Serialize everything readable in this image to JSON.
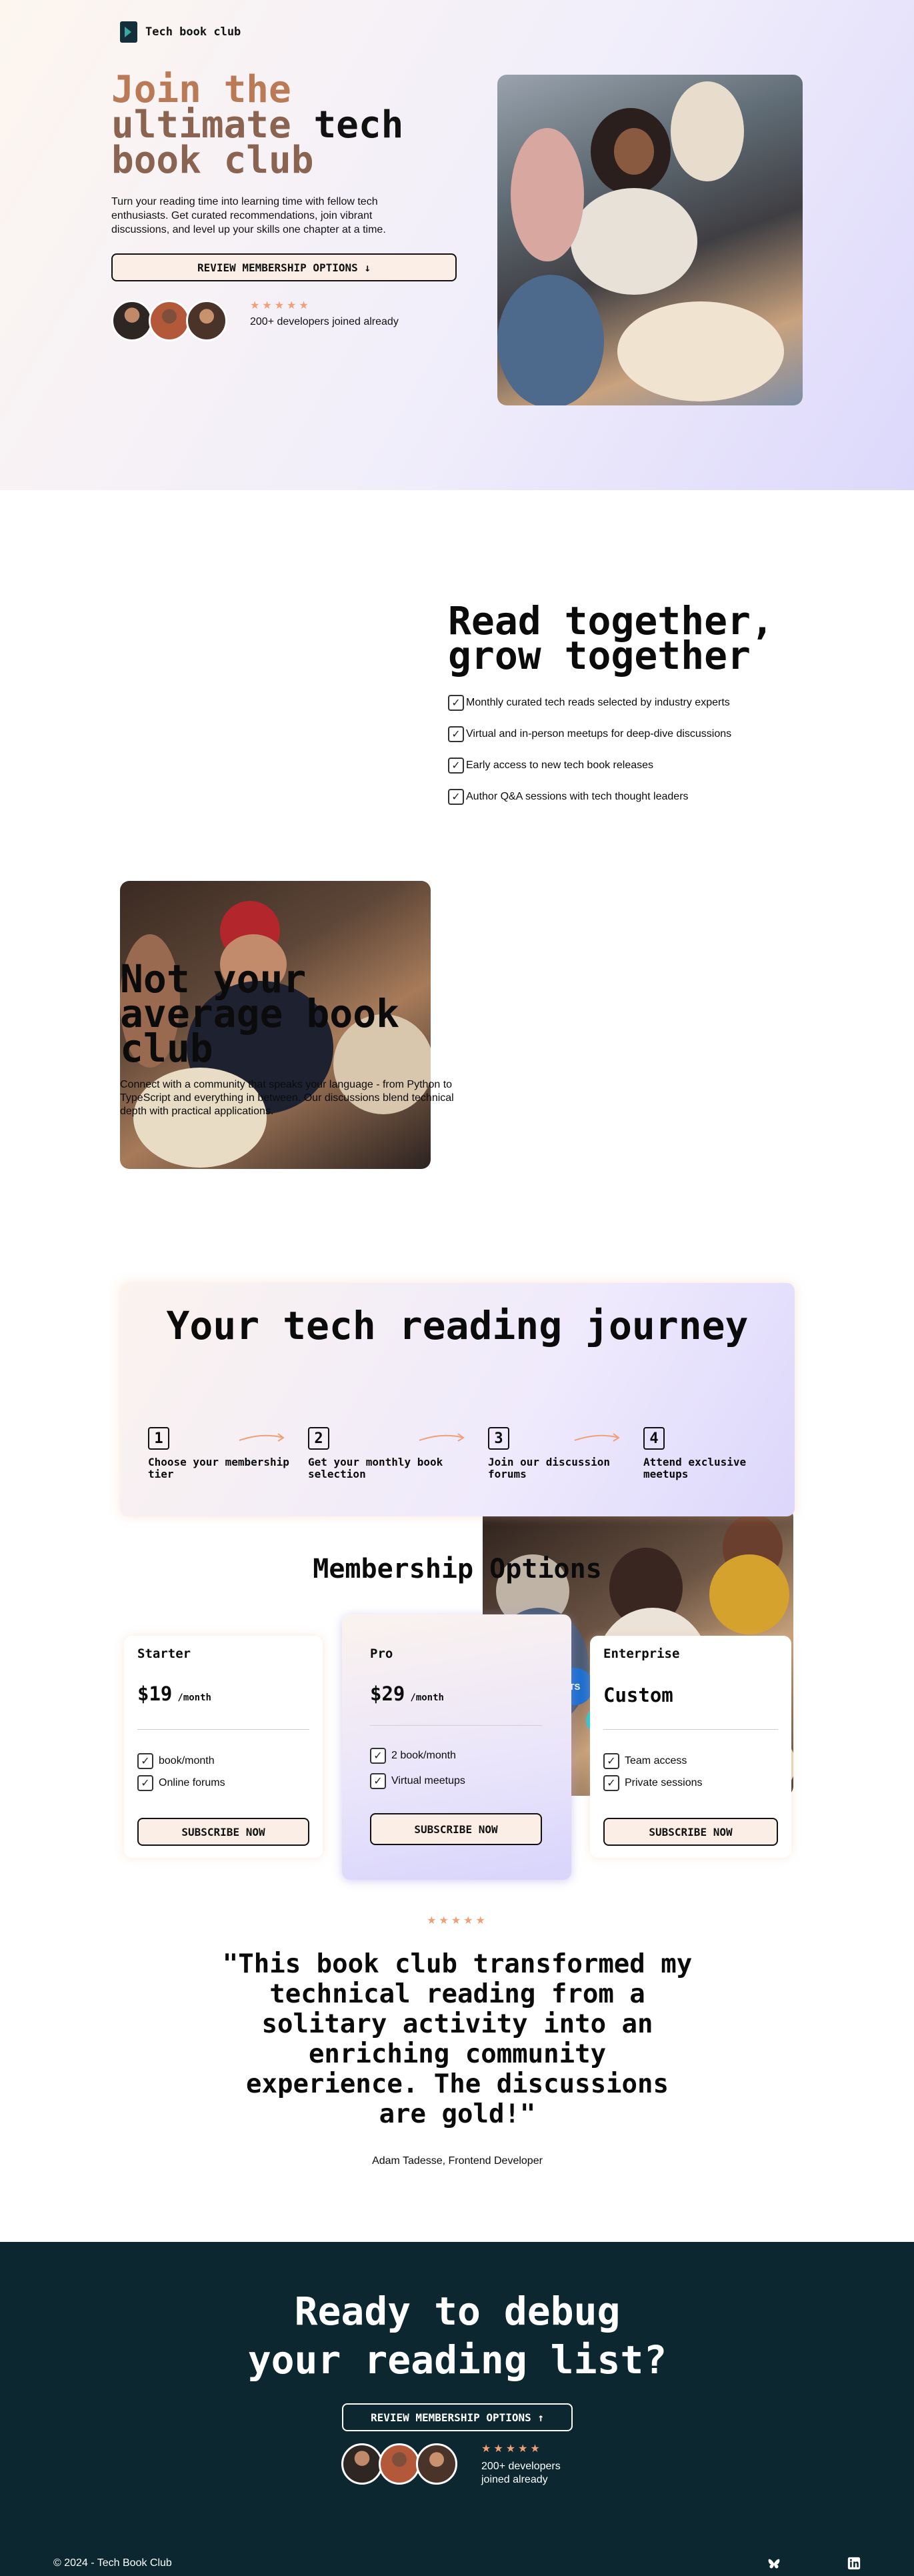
{
  "brand": {
    "name": "Tech book club"
  },
  "hero": {
    "title_line1": "Join the",
    "title_line2a": "ultimate",
    "title_line2b": "tech",
    "title_line3": "book club",
    "description": "Turn your reading time into learning time with fellow tech enthusiasts. Get curated recommendations, join vibrant discussions, and level up your skills one chapter at a time.",
    "cta_label": "REVIEW MEMBERSHIP OPTIONS ↓",
    "stars": "★★★★★",
    "joined_text": "200+ developers joined already"
  },
  "read_together": {
    "title": "Read together, grow together",
    "features": [
      "Monthly curated tech reads selected by industry experts",
      "Virtual and in-person meetups for deep-dive discussions",
      "Early access to new tech book releases",
      "Author Q&A sessions with tech thought leaders"
    ]
  },
  "not_average": {
    "title": "Not your average book club",
    "description": "Connect with a community that speaks your language - from Python to TypeScript and everything in between. Our discussions blend technical depth with practical applications.",
    "badges": {
      "ts": "TS"
    }
  },
  "journey": {
    "title": "Your tech reading journey",
    "steps": [
      {
        "num": "1",
        "label": "Choose your membership tier"
      },
      {
        "num": "2",
        "label": "Get your monthly book selection"
      },
      {
        "num": "3",
        "label": "Join our discussion forums"
      },
      {
        "num": "4",
        "label": "Attend exclusive meetups"
      }
    ]
  },
  "membership": {
    "title": "Membership Options",
    "plans": [
      {
        "name": "Starter",
        "price": "$19",
        "per": "/month",
        "features": [
          "book/month",
          "Online forums"
        ],
        "button": "SUBSCRIBE NOW"
      },
      {
        "name": "Pro",
        "price": "$29",
        "per": "/month",
        "features": [
          "2 book/month",
          "Virtual meetups"
        ],
        "button": "SUBSCRIBE NOW"
      },
      {
        "name": "Enterprise",
        "price": "Custom",
        "per": "",
        "features": [
          "Team access",
          "Private sessions"
        ],
        "button": "SUBSCRIBE NOW"
      }
    ]
  },
  "testimonial": {
    "stars": "★★★★★",
    "quote": "\"This book club transformed my technical reading from a solitary activity into an enriching community experience. The discussions are gold!\"",
    "author": "Adam Tadesse, Frontend Developer"
  },
  "cta": {
    "title_line1": "Ready to debug",
    "title_line2": "your reading list?",
    "button": "REVIEW MEMBERSHIP OPTIONS ↑",
    "stars": "★★★★★",
    "joined_line1": "200+ developers",
    "joined_line2": "joined already"
  },
  "footer": {
    "copyright": "© 2024 - Tech Book Club"
  },
  "colors": {
    "accent": "#b97a55",
    "dark": "#0c2730",
    "star": "#f0a078"
  },
  "icons": [
    "book-logo-icon",
    "check-icon",
    "arrow-icon",
    "github-icon",
    "react-icon",
    "typescript-icon",
    "butterfly-icon",
    "linkedin-icon"
  ]
}
